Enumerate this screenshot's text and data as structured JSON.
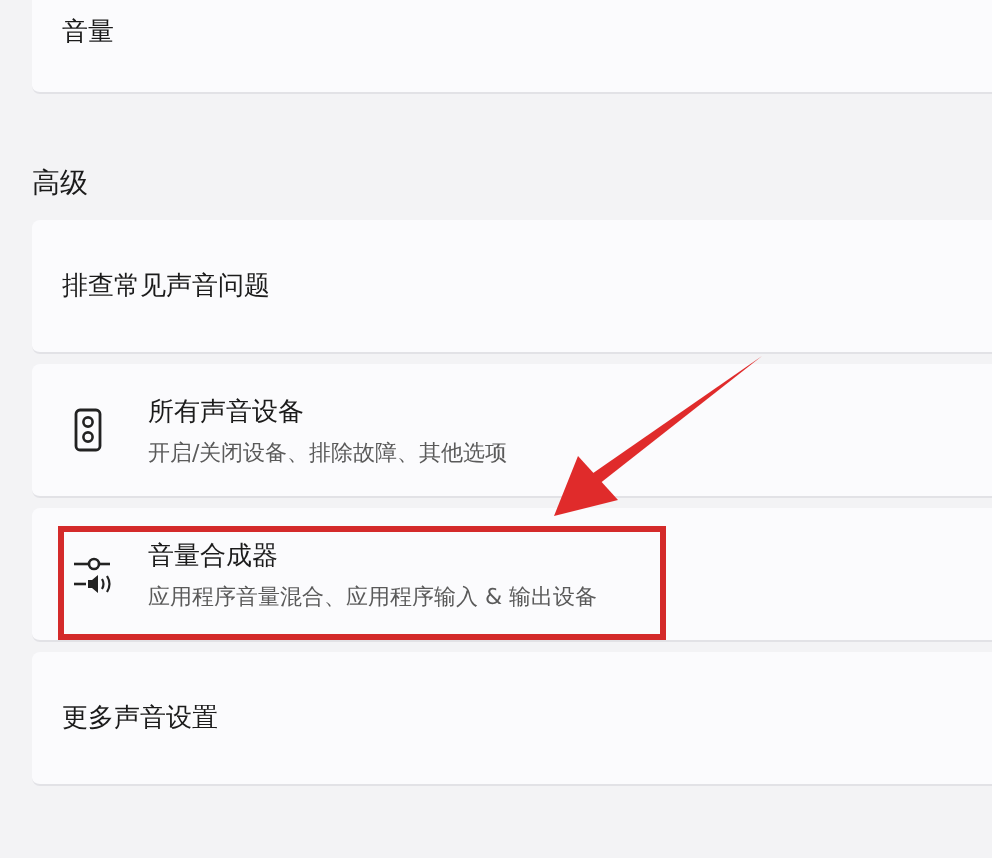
{
  "top_card": {
    "label": "音量"
  },
  "section": {
    "title": "高级"
  },
  "items": [
    {
      "kind": "plain",
      "title": "排查常见声音问题",
      "highlighted": false
    },
    {
      "kind": "speaker",
      "title": "所有声音设备",
      "subtitle": "开启/关闭设备、排除故障、其他选项",
      "highlighted": false
    },
    {
      "kind": "mixer",
      "title": "音量合成器",
      "subtitle": "应用程序音量混合、应用程序输入 & 输出设备",
      "highlighted": true
    },
    {
      "kind": "plain",
      "title": "更多声音设置",
      "highlighted": false
    }
  ]
}
